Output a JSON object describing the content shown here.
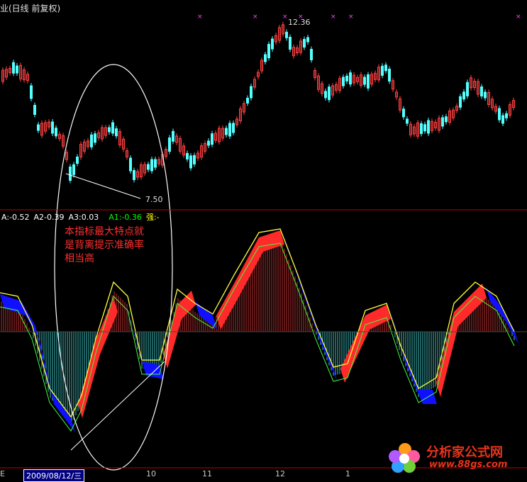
{
  "window": {
    "title": "业(日线 前复权)"
  },
  "price_panel": {
    "high_label": "12.36",
    "low_label": "7.50"
  },
  "indicator": {
    "readouts": [
      {
        "text": "A:-0.52",
        "color": "#ffffff"
      },
      {
        "text": "A2-0.39",
        "color": "#ffffff"
      },
      {
        "text": "A3:0.03",
        "color": "#ffffff"
      },
      {
        "text": "A1:-0.36",
        "color": "#00ff00"
      },
      {
        "text": "强:-",
        "color": "#ffff00"
      }
    ],
    "annotation_line1": "本指标最大特点就",
    "annotation_line2": "是背离提示准确率",
    "annotation_line3": "相当高"
  },
  "x_axis": {
    "cursor_date": "2009/08/12/三",
    "left_mark": "E",
    "month_labels": [
      "10",
      "11",
      "12",
      "1"
    ]
  },
  "watermark": {
    "brand": "分析家公式网",
    "url": "www.88gs.com"
  },
  "colors": {
    "up": "#ff4040",
    "down": "#54ffff",
    "red_band": "#ff2a2a",
    "blue_band": "#1010ff",
    "frame": "#c00000"
  }
}
